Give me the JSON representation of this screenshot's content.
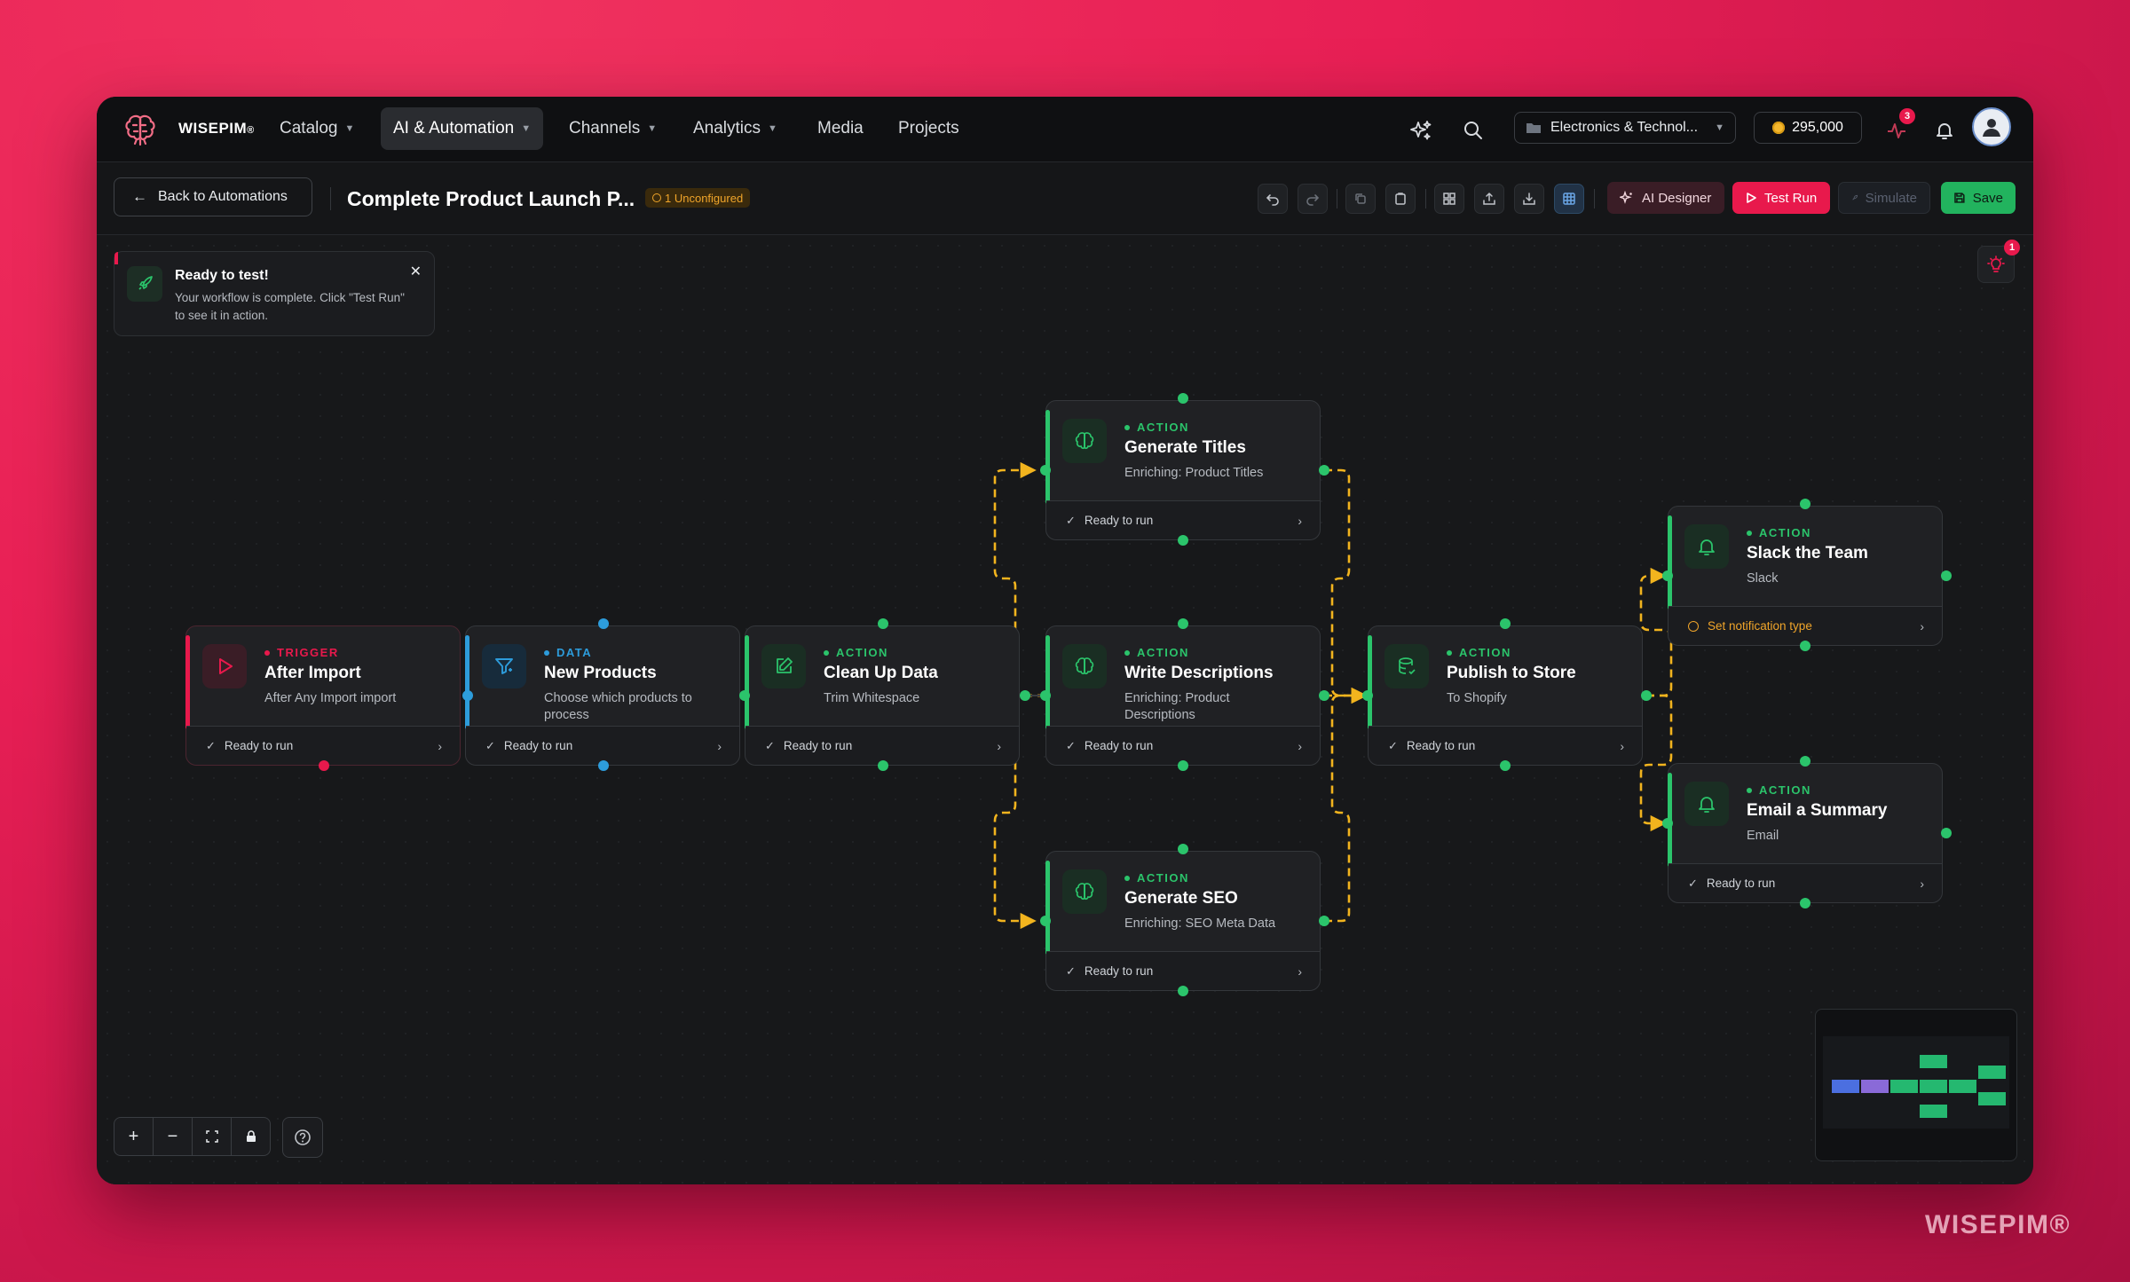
{
  "brand": {
    "name": "WISEPIM",
    "mark": "®"
  },
  "nav": {
    "items": [
      {
        "label": "Catalog"
      },
      {
        "label": "AI & Automation"
      },
      {
        "label": "Channels"
      },
      {
        "label": "Analytics"
      },
      {
        "label": "Media"
      },
      {
        "label": "Projects"
      }
    ],
    "workspace": "Electronics & Technol...",
    "credits": "295,000",
    "activity_badge": "3"
  },
  "toolbar": {
    "back_label": "Back to Automations",
    "title": "Complete Product Launch P...",
    "unconfigured": "1 Unconfigured",
    "ai_designer": "AI Designer",
    "test_run": "Test Run",
    "simulate": "Simulate",
    "save": "Save"
  },
  "toast": {
    "title": "Ready to test!",
    "message": "Your workflow is complete. Click \"Test Run\" to see it in action."
  },
  "suggestions_badge": "1",
  "nodes": [
    {
      "type": "TRIGGER",
      "title": "After Import",
      "subtitle": "After Any Import import",
      "footer": "Ready to run"
    },
    {
      "type": "DATA",
      "title": "New Products",
      "subtitle": "Choose which products to process",
      "footer": "Ready to run"
    },
    {
      "type": "ACTION",
      "title": "Clean Up Data",
      "subtitle": "Trim Whitespace",
      "footer": "Ready to run"
    },
    {
      "type": "ACTION",
      "title": "Generate Titles",
      "subtitle": "Enriching: Product Titles",
      "footer": "Ready to run"
    },
    {
      "type": "ACTION",
      "title": "Write Descriptions",
      "subtitle": "Enriching: Product Descriptions",
      "footer": "Ready to run"
    },
    {
      "type": "ACTION",
      "title": "Generate SEO",
      "subtitle": "Enriching: SEO Meta Data",
      "footer": "Ready to run"
    },
    {
      "type": "ACTION",
      "title": "Publish to Store",
      "subtitle": "To Shopify",
      "footer": "Ready to run"
    },
    {
      "type": "ACTION",
      "title": "Slack the Team",
      "subtitle": "Slack",
      "footer": "Set notification type"
    },
    {
      "type": "ACTION",
      "title": "Email a Summary",
      "subtitle": "Email",
      "footer": "Ready to run"
    }
  ],
  "colors": {
    "trigger": "#e8194c",
    "data": "#2d9cdb",
    "action": "#2bc46b",
    "warning": "#f0a52a",
    "edge": "#f2b41e"
  },
  "icons": {
    "trigger": "play-icon",
    "data": "filter-icon",
    "clean": "edit-icon",
    "ai": "brain-icon",
    "publish": "database-icon",
    "notify": "bell-icon"
  },
  "watermark": "WISEPIM®"
}
